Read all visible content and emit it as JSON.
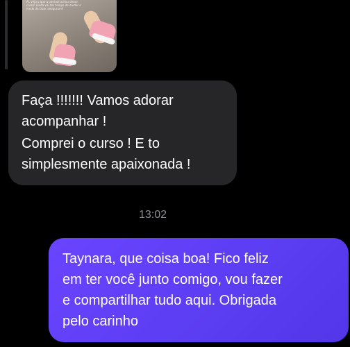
{
  "conversation": {
    "replied_story": {
      "caption": "Ai, veja o que o pessoal achou desse curso! Ainda vai dar tempo de mudar o modo de fazer amigurumi!"
    },
    "incoming_message": {
      "lines": [
        "Faça !!!!!!! Vamos adorar\nacompanhar !",
        "Comprei o curso ! E to\nsimplesmente apaixonada !"
      ]
    },
    "timestamp": "13:02",
    "outgoing_message": {
      "text": "Taynara, que coisa boa! Fico feliz\nem ter você junto comigo, vou fazer\ne compartilhar tudo aqui. Obrigada\npelo carinho"
    }
  },
  "colors": {
    "background": "#000000",
    "incoming_bubble": "#262628",
    "outgoing_bubble": "#5b3df2",
    "timestamp_text": "#8e8e93"
  }
}
